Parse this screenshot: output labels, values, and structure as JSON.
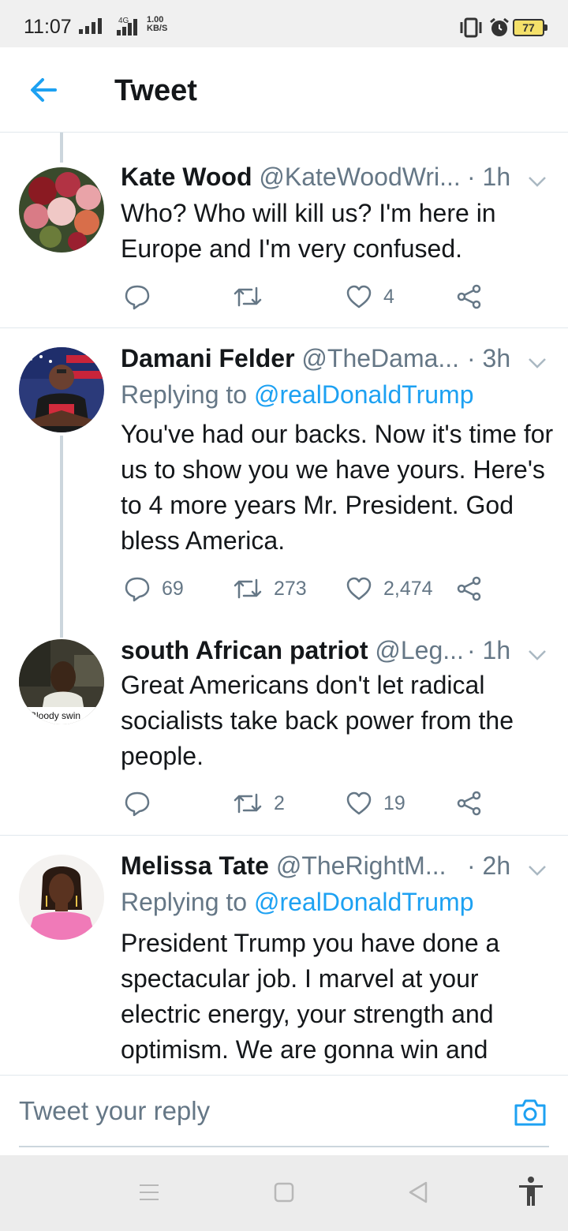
{
  "status_bar": {
    "time": "11:07",
    "network": "4G",
    "speed_value": "1.00",
    "speed_unit": "KB/S",
    "battery": "77"
  },
  "header": {
    "title": "Tweet"
  },
  "tweets": [
    {
      "name": "Kate Wood",
      "handle": "@KateWoodWri...",
      "time": "· 1h",
      "text": "Who? Who will kill us? I'm here in Europe and I'm very confused.",
      "reply_count": "",
      "retweet_count": "",
      "like_count": "4"
    },
    {
      "name": "Damani Felder",
      "handle": "@TheDama...",
      "time": "· 3h",
      "replying_prefix": "Replying to",
      "replying_to": "@realDonaldTrump",
      "text": "You've had our backs. Now it's time for us to show you we have yours. Here's to 4 more years Mr. President. God bless America.",
      "reply_count": "69",
      "retweet_count": "273",
      "like_count": "2,474"
    },
    {
      "name": "south African patriot",
      "handle": "@Leg...",
      "time": "· 1h",
      "text": "Great Americans don't let radical socialists take back power from the people.",
      "reply_count": "",
      "retweet_count": "2",
      "like_count": "19",
      "avatar_caption": "Bloody swin"
    },
    {
      "name": "Melissa Tate",
      "handle": "@TheRightM...",
      "time": "· 2h",
      "replying_prefix": "Replying to",
      "replying_to": "@realDonaldTrump",
      "text": "President Trump you have done a spectacular job. I marvel at your electric energy, your strength and optimism. We are gonna win and"
    }
  ],
  "reply_bar": {
    "placeholder": "Tweet your reply"
  },
  "colors": {
    "accent": "#1da1f2",
    "secondary_text": "#657786",
    "primary_text": "#14171a",
    "divider": "#e1e8ed"
  },
  "icons": [
    "back-arrow-icon",
    "chevron-down-icon",
    "reply-icon",
    "retweet-icon",
    "like-icon",
    "share-icon",
    "camera-icon",
    "menu-icon",
    "home-icon",
    "back-icon",
    "accessibility-icon"
  ]
}
